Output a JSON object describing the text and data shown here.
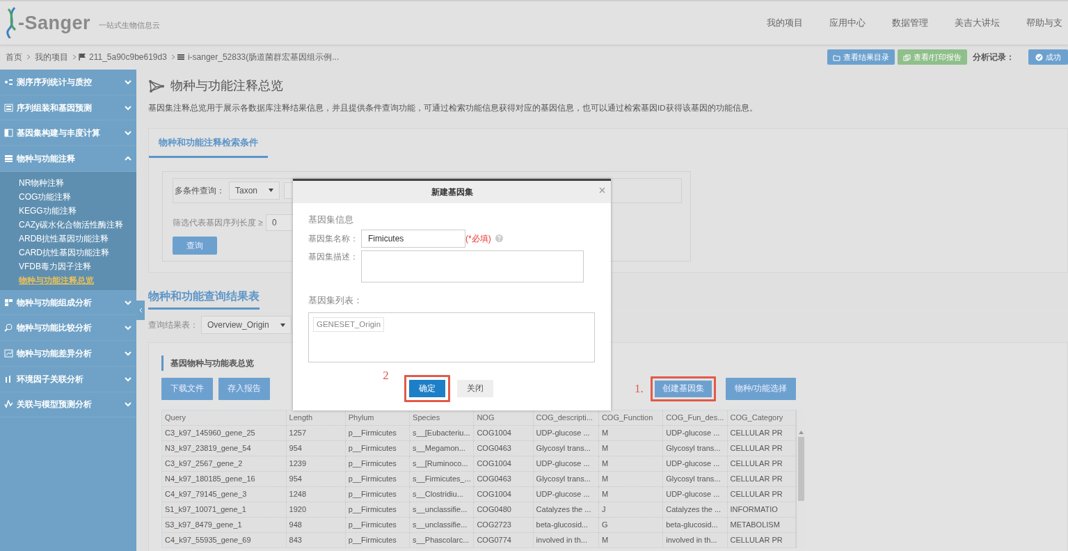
{
  "logo": {
    "name": "-Sanger",
    "tagline": "一站式生物信息云"
  },
  "top_nav": [
    "我的项目",
    "应用中心",
    "数据管理",
    "美吉大讲坛",
    "帮助与支"
  ],
  "breadcrumb": [
    {
      "text": "首页",
      "kind": "plain"
    },
    {
      "text": "我的项目",
      "kind": "plain"
    },
    {
      "text": "211_5a90c9be619d3",
      "kind": "flag"
    },
    {
      "text": "i-sanger_52833(肠道菌群宏基因组示例...",
      "kind": "list"
    }
  ],
  "actions": [
    {
      "label": "查看结果目录",
      "kind": "folder"
    },
    {
      "label": "查看/打印报告",
      "kind": "report"
    }
  ],
  "record_label": "分析记录：",
  "status_button": "成功",
  "sidebar": [
    {
      "label": "测序序列统计与质控",
      "expanded": false
    },
    {
      "label": "序列组装和基因预测",
      "expanded": false
    },
    {
      "label": "基因集构建与丰度计算",
      "expanded": false
    },
    {
      "label": "物种与功能注释",
      "expanded": true,
      "children": [
        {
          "label": "NR物种注释",
          "selected": false
        },
        {
          "label": "COG功能注释",
          "selected": false
        },
        {
          "label": "KEGG功能注释",
          "selected": false
        },
        {
          "label": "CAZy碳水化合物活性酶注释",
          "selected": false
        },
        {
          "label": "ARDB抗性基因功能注释",
          "selected": false
        },
        {
          "label": "CARD抗性基因功能注释",
          "selected": false
        },
        {
          "label": "VFDB毒力因子注释",
          "selected": false
        },
        {
          "label": "物种与功能注释总览",
          "selected": true
        }
      ]
    },
    {
      "label": "物种与功能组成分析",
      "expanded": false
    },
    {
      "label": "物种与功能比较分析",
      "expanded": false
    },
    {
      "label": "物种与功能差异分析",
      "expanded": false
    },
    {
      "label": "环境因子关联分析",
      "expanded": false
    },
    {
      "label": "关联与模型预测分析",
      "expanded": false
    }
  ],
  "page": {
    "title": "物种与功能注释总览",
    "description": "基因集注释总览用于展示各数据库注释结果信息，并且提供条件查询功能，可通过检索功能信息获得对应的基因信息，也可以通过检索基因ID获得该基因的功能信息。"
  },
  "search_panel": {
    "tab": "物种和功能注释检索条件",
    "multi_label": "多条件查询：",
    "select": "Taxon",
    "length_label": "筛选代表基因序列长度 ≥",
    "length_value": "0",
    "query_button": "查询"
  },
  "results": {
    "heading": "物种和功能查询结果表",
    "select_label": "查询结果表：",
    "select": "Overview_Origin",
    "panel_title": "基因物种与功能表总览",
    "left_buttons": [
      "下载文件",
      "存入报告"
    ],
    "right_buttons": [
      {
        "label": "创建基因集",
        "highlighted": true,
        "step": "1."
      },
      {
        "label": "物种/功能选择",
        "highlighted": false
      }
    ],
    "table": {
      "columns": [
        "Query",
        "Length",
        "Phylum",
        "Species",
        "NOG",
        "COG_descripti...",
        "COG_Function",
        "COG_Fun_des...",
        "COG_Category"
      ],
      "rows": [
        [
          "C3_k97_145960_gene_25",
          "1257",
          "p__Firmicutes",
          "s__[Eubacteriu...",
          "COG1004",
          "UDP-glucose ...",
          "M",
          "UDP-glucose ...",
          "CELLULAR PR"
        ],
        [
          "N3_k97_23819_gene_54",
          "954",
          "p__Firmicutes",
          "s__Megamon...",
          "COG0463",
          "Glycosyl trans...",
          "M",
          "Glycosyl trans...",
          "CELLULAR PR"
        ],
        [
          "C3_k97_2567_gene_2",
          "1239",
          "p__Firmicutes",
          "s__[Ruminoco...",
          "COG1004",
          "UDP-glucose ...",
          "M",
          "UDP-glucose ...",
          "CELLULAR PR"
        ],
        [
          "N4_k97_180185_gene_16",
          "954",
          "p__Firmicutes",
          "s__Firmicutes_...",
          "COG0463",
          "Glycosyl trans...",
          "M",
          "Glycosyl trans...",
          "CELLULAR PR"
        ],
        [
          "C4_k97_79145_gene_3",
          "1248",
          "p__Firmicutes",
          "s__Clostridiu...",
          "COG1004",
          "UDP-glucose ...",
          "M",
          "UDP-glucose ...",
          "CELLULAR PR"
        ],
        [
          "S1_k97_10071_gene_1",
          "1920",
          "p__Firmicutes",
          "s__unclassifie...",
          "COG0480",
          "Catalyzes the ...",
          "J",
          "Catalyzes the ...",
          "INFORMATIO"
        ],
        [
          "S3_k97_8479_gene_1",
          "948",
          "p__Firmicutes",
          "s__unclassifie...",
          "COG2723",
          "beta-glucosid...",
          "G",
          "beta-glucosid...",
          "METABOLISM"
        ],
        [
          "C4_k97_55935_gene_69",
          "843",
          "p__Firmicutes",
          "s__Phascolarc...",
          "COG0774",
          "involved in th...",
          "M",
          "involved in th...",
          "CELLULAR PR"
        ]
      ]
    }
  },
  "modal": {
    "title": "新建基因集",
    "section": "基因集信息",
    "name_label": "基因集名称：",
    "name_value": "Fimicutes",
    "required": "(*必填)",
    "desc_label": "基因集描述：",
    "list_label": "基因集列表：",
    "list_items": [
      "GENESET_Origin"
    ],
    "buttons": [
      {
        "label": "确定",
        "kind": "primary",
        "highlighted": true,
        "step": "2"
      },
      {
        "label": "关闭",
        "kind": "secondary",
        "highlighted": false
      }
    ]
  }
}
